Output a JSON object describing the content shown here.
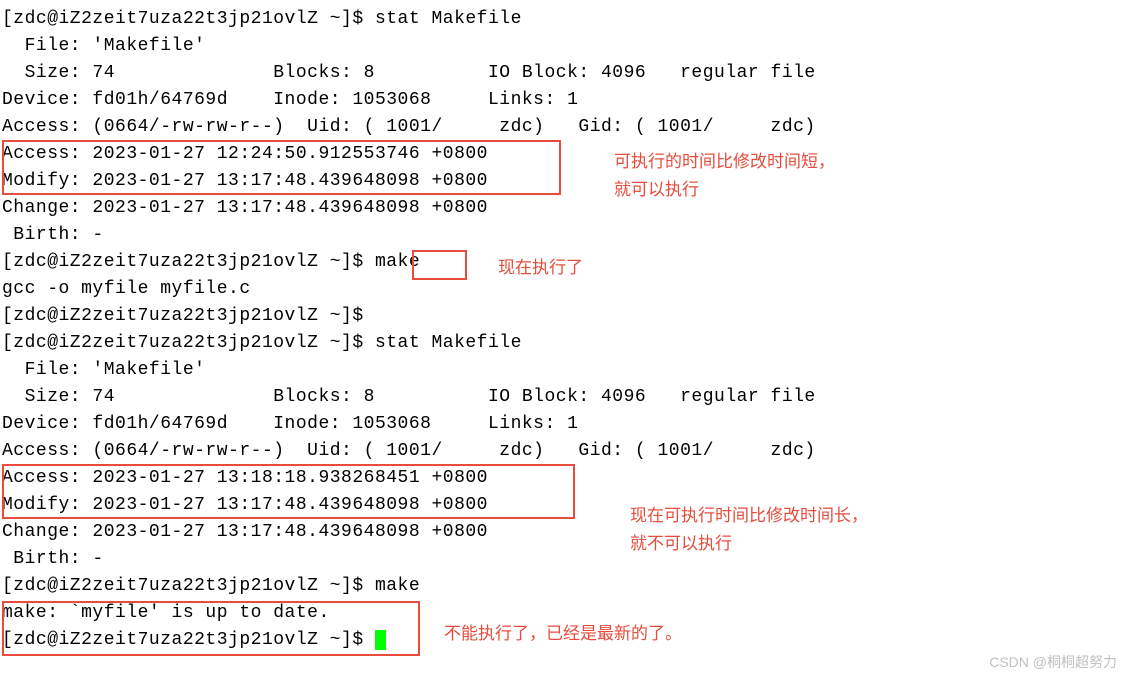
{
  "terminal": {
    "prompt": "[zdc@iZ2zeit7uza22t3jp21ovlZ ~]$",
    "lines": [
      "[zdc@iZ2zeit7uza22t3jp21ovlZ ~]$ stat Makefile",
      "  File: 'Makefile'",
      "  Size: 74              Blocks: 8          IO Block: 4096   regular file",
      "Device: fd01h/64769d    Inode: 1053068     Links: 1",
      "Access: (0664/-rw-rw-r--)  Uid: ( 1001/     zdc)   Gid: ( 1001/     zdc)",
      "Access: 2023-01-27 12:24:50.912553746 +0800",
      "Modify: 2023-01-27 13:17:48.439648098 +0800",
      "Change: 2023-01-27 13:17:48.439648098 +0800",
      " Birth: -",
      "[zdc@iZ2zeit7uza22t3jp21ovlZ ~]$ make",
      "gcc -o myfile myfile.c",
      "[zdc@iZ2zeit7uza22t3jp21ovlZ ~]$",
      "[zdc@iZ2zeit7uza22t3jp21ovlZ ~]$ stat Makefile",
      "  File: 'Makefile'",
      "  Size: 74              Blocks: 8          IO Block: 4096   regular file",
      "Device: fd01h/64769d    Inode: 1053068     Links: 1",
      "Access: (0664/-rw-rw-r--)  Uid: ( 1001/     zdc)   Gid: ( 1001/     zdc)",
      "Access: 2023-01-27 13:18:18.938268451 +0800",
      "Modify: 2023-01-27 13:17:48.439648098 +0800",
      "Change: 2023-01-27 13:17:48.439648098 +0800",
      " Birth: -",
      "[zdc@iZ2zeit7uza22t3jp21ovlZ ~]$ make",
      "make: `myfile' is up to date.",
      "[zdc@iZ2zeit7uza22t3jp21ovlZ ~]$ "
    ]
  },
  "annotations": {
    "note1_line1": "可执行的时间比修改时间短，",
    "note1_line2": "就可以执行",
    "note2": "现在执行了",
    "note3_line1": "现在可执行时间比修改时间长，",
    "note3_line2": "就不可以执行",
    "note4": "不能执行了，已经是最新的了。"
  },
  "watermark": "CSDN @桐桐超努力",
  "colors": {
    "annotation_red": "#e74c3c",
    "cursor_green": "#00ff00"
  },
  "stat_output_1": {
    "file": "Makefile",
    "size": 74,
    "blocks": 8,
    "io_block": 4096,
    "type": "regular file",
    "device": "fd01h/64769d",
    "inode": 1053068,
    "links": 1,
    "access_perm": "(0664/-rw-rw-r--)",
    "uid": "( 1001/     zdc)",
    "gid": "( 1001/     zdc)",
    "access_time": "2023-01-27 12:24:50.912553746 +0800",
    "modify_time": "2023-01-27 13:17:48.439648098 +0800",
    "change_time": "2023-01-27 13:17:48.439648098 +0800",
    "birth": "-"
  },
  "stat_output_2": {
    "file": "Makefile",
    "size": 74,
    "blocks": 8,
    "io_block": 4096,
    "type": "regular file",
    "device": "fd01h/64769d",
    "inode": 1053068,
    "links": 1,
    "access_perm": "(0664/-rw-rw-r--)",
    "uid": "( 1001/     zdc)",
    "gid": "( 1001/     zdc)",
    "access_time": "2023-01-27 13:18:18.938268451 +0800",
    "modify_time": "2023-01-27 13:17:48.439648098 +0800",
    "change_time": "2023-01-27 13:17:48.439648098 +0800",
    "birth": "-"
  },
  "commands": {
    "cmd1": "stat Makefile",
    "cmd2": "make",
    "cmd3": "stat Makefile",
    "cmd4": "make"
  },
  "make_output_1": "gcc -o myfile myfile.c",
  "make_output_2": "make: `myfile' is up to date."
}
